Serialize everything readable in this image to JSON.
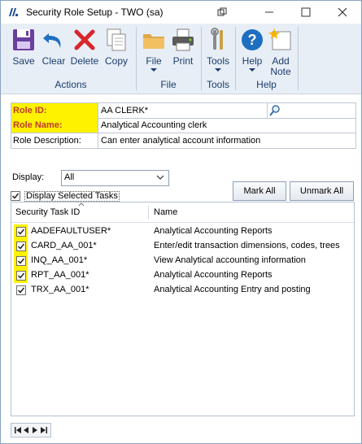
{
  "window": {
    "title": "Security Role Setup  -  TWO (sa)",
    "restore_glyph": "⧉",
    "minimize_glyph": "—",
    "maximize_glyph": "☐",
    "close_glyph": "✕"
  },
  "ribbon": {
    "buttons": {
      "save": "Save",
      "clear": "Clear",
      "delete": "Delete",
      "copy": "Copy",
      "file": "File",
      "print": "Print",
      "tools": "Tools",
      "help": "Help",
      "add_note_line1": "Add",
      "add_note_line2": "Note"
    },
    "groups": {
      "actions": "Actions",
      "file": "File",
      "tools": "Tools",
      "help": "Help"
    },
    "colors": {
      "accent": "#1a3d6e",
      "background": "#e8eef6"
    }
  },
  "form": {
    "role_id_label": "Role ID:",
    "role_id_value": "AA CLERK*",
    "role_name_label": "Role Name:",
    "role_name_value": "Analytical Accounting clerk",
    "role_description_label": "Role Description:",
    "role_description_value": "Can enter analytical account information",
    "highlight_color": "#fff200",
    "display_label": "Display:",
    "display_value": "All",
    "display_selected_label": "Display Selected Tasks",
    "mark_all": "Mark All",
    "unmark_all": "Unmark All"
  },
  "grid": {
    "headers": [
      "Security Task ID",
      "Name"
    ],
    "rows": [
      {
        "id": "AADEFAULTUSER*",
        "name": "Analytical Accounting Reports",
        "checked": true
      },
      {
        "id": "CARD_AA_001*",
        "name": "Enter/edit transaction dimensions, codes, trees",
        "checked": true
      },
      {
        "id": "INQ_AA_001*",
        "name": "View Analytical accounting information",
        "checked": true
      },
      {
        "id": "RPT_AA_001*",
        "name": "Analytical Accounting Reports",
        "checked": true
      },
      {
        "id": "TRX_AA_001*",
        "name": "Analytical Accounting Entry and posting",
        "checked": true
      }
    ]
  },
  "nav": {
    "first": "first-record",
    "prev": "previous-record",
    "next": "next-record",
    "last": "last-record"
  }
}
